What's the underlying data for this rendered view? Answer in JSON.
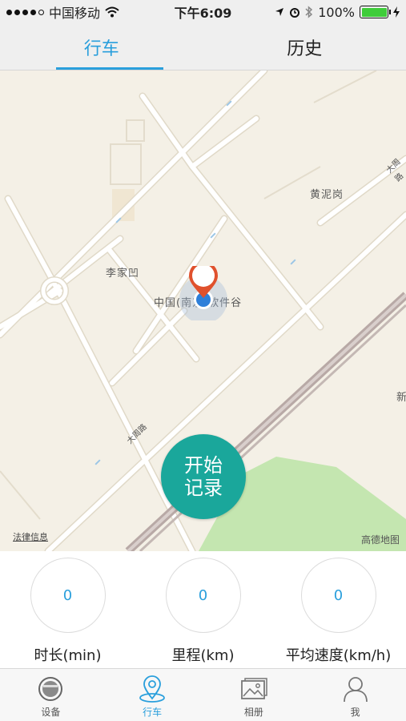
{
  "status_bar": {
    "carrier": "中国移动",
    "time": "下午6:09",
    "battery": "100%",
    "battery_level": 1.0
  },
  "top_tabs": [
    {
      "label": "行车",
      "active": true
    },
    {
      "label": "历史",
      "active": false
    }
  ],
  "map": {
    "labels": {
      "huangnigang": "黄泥岗",
      "lijiaao": "李家凹",
      "software_valley": "中国(南京)软件谷",
      "xin": "新",
      "dazhou_road_1": "大周路",
      "dazhou_road_2": "大周路"
    },
    "legal_link": "法律信息",
    "provider": "高德地图",
    "colors": {
      "background": "#f4f0e6",
      "park": "#c4e6b0",
      "road": "#ffffff",
      "rail": "#a89a98"
    }
  },
  "start_button": {
    "line1": "开始",
    "line2": "记录",
    "color": "#1aa79b"
  },
  "stats": [
    {
      "value": "0",
      "label": "时长(min)"
    },
    {
      "value": "0",
      "label": "里程(km)"
    },
    {
      "value": "0",
      "label": "平均速度(km/h)"
    }
  ],
  "bottom_nav": [
    {
      "label": "设备",
      "icon": "device-icon",
      "active": false
    },
    {
      "label": "行车",
      "icon": "location-pin-icon",
      "active": true
    },
    {
      "label": "相册",
      "icon": "album-icon",
      "active": false
    },
    {
      "label": "我",
      "icon": "user-icon",
      "active": false
    }
  ],
  "accent_color": "#2a9fdc"
}
